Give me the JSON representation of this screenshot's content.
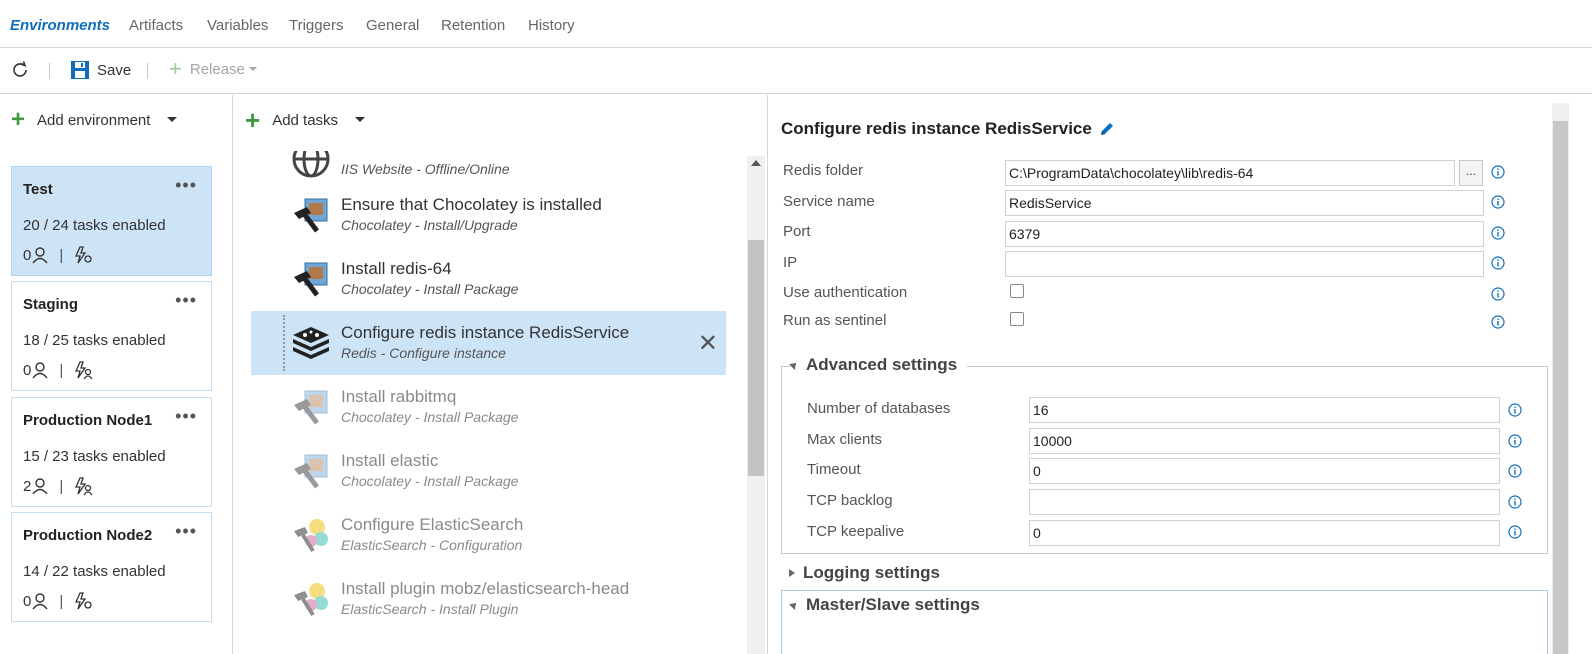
{
  "nav": {
    "tabs": [
      {
        "label": "Environments",
        "active": true
      },
      {
        "label": "Artifacts"
      },
      {
        "label": "Variables"
      },
      {
        "label": "Triggers"
      },
      {
        "label": "General"
      },
      {
        "label": "Retention"
      },
      {
        "label": "History"
      }
    ]
  },
  "toolbar": {
    "refresh_icon": "refresh-icon",
    "save_label": "Save",
    "release_label": "Release"
  },
  "environments": {
    "add_label": "Add environment",
    "items": [
      {
        "name": "Test",
        "tasks": "20 / 24 tasks enabled",
        "approvers": "0",
        "selected": true
      },
      {
        "name": "Staging",
        "tasks": "18 / 25 tasks enabled",
        "approvers": "0"
      },
      {
        "name": "Production Node1",
        "tasks": "15 / 23 tasks enabled",
        "approvers": "2"
      },
      {
        "name": "Production Node2",
        "tasks": "14 / 22 tasks enabled",
        "approvers": "0"
      }
    ]
  },
  "tasks": {
    "add_label": "Add tasks",
    "items": [
      {
        "name": "",
        "sub": "IIS Website - Offline/Online",
        "icon": "globe-icon"
      },
      {
        "name": "Ensure that Chocolatey is installed",
        "sub": "Chocolatey - Install/Upgrade",
        "icon": "chocolatey-icon"
      },
      {
        "name": "Install redis-64",
        "sub": "Chocolatey - Install Package",
        "icon": "chocolatey-icon"
      },
      {
        "name": "Configure redis instance RedisService",
        "sub": "Redis - Configure instance",
        "icon": "redis-icon",
        "selected": true
      },
      {
        "name": "Install rabbitmq",
        "sub": "Chocolatey - Install Package",
        "icon": "chocolatey-icon",
        "disabled": true
      },
      {
        "name": "Install elastic",
        "sub": "Chocolatey - Install Package",
        "icon": "chocolatey-icon",
        "disabled": true
      },
      {
        "name": "Configure ElasticSearch",
        "sub": "ElasticSearch - Configuration",
        "icon": "elasticsearch-icon",
        "disabled": true
      },
      {
        "name": "Install plugin mobz/elasticsearch-head",
        "sub": "ElasticSearch - Install Plugin",
        "icon": "elasticsearch-icon",
        "disabled": true
      }
    ]
  },
  "details": {
    "title": "Configure redis instance RedisService",
    "fields": {
      "redis_folder": {
        "label": "Redis folder",
        "value": "C:\\ProgramData\\chocolatey\\lib\\redis-64"
      },
      "service_name": {
        "label": "Service name",
        "value": "RedisService"
      },
      "port": {
        "label": "Port",
        "value": "6379"
      },
      "ip": {
        "label": "IP",
        "value": ""
      },
      "use_auth": {
        "label": "Use authentication",
        "checked": false
      },
      "sentinel": {
        "label": "Run as sentinel",
        "checked": false
      }
    },
    "browse_label": "...",
    "advanced": {
      "heading": "Advanced settings",
      "num_db": {
        "label": "Number of databases",
        "value": "16"
      },
      "max_clients": {
        "label": "Max clients",
        "value": "10000"
      },
      "timeout": {
        "label": "Timeout",
        "value": "0"
      },
      "tcp_backlog": {
        "label": "TCP backlog",
        "value": ""
      },
      "tcp_keepalive": {
        "label": "TCP keepalive",
        "value": "0"
      }
    },
    "logging_heading": "Logging settings",
    "master_heading": "Master/Slave settings"
  },
  "colors": {
    "accent": "#106ebe",
    "selected": "#cde3f6",
    "green": "#3f9a3f"
  }
}
